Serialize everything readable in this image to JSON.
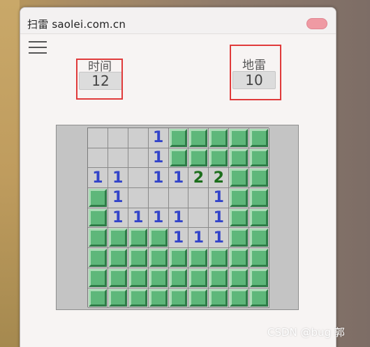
{
  "window": {
    "title": "扫雷 saolei.com.cn"
  },
  "counters": {
    "time": {
      "label": "时间",
      "value": "12"
    },
    "mines": {
      "label": "地雷",
      "value": "10"
    }
  },
  "board": {
    "rows": [
      [
        " ",
        " ",
        " ",
        "1",
        "#",
        "#",
        "#",
        "#",
        "#"
      ],
      [
        " ",
        " ",
        " ",
        "1",
        "#",
        "#",
        "#",
        "#",
        "#"
      ],
      [
        "1",
        "1",
        " ",
        "1",
        "1",
        "2",
        "2",
        "#",
        "#"
      ],
      [
        "#",
        "1",
        " ",
        " ",
        " ",
        " ",
        "1",
        "#",
        "#"
      ],
      [
        "#",
        "1",
        "1",
        "1",
        "1",
        " ",
        "1",
        "#",
        "#"
      ],
      [
        "#",
        "#",
        "#",
        "#",
        "1",
        "1",
        "1",
        "#",
        "#"
      ],
      [
        "#",
        "#",
        "#",
        "#",
        "#",
        "#",
        "#",
        "#",
        "#"
      ],
      [
        "#",
        "#",
        "#",
        "#",
        "#",
        "#",
        "#",
        "#",
        "#"
      ],
      [
        "#",
        "#",
        "#",
        "#",
        "#",
        "#",
        "#",
        "#",
        "#"
      ]
    ]
  },
  "colors": {
    "number_1": "#3344c9",
    "number_2": "#1c6e1c",
    "covered_tile": "#5eb77a",
    "highlight_box": "#e03a3a"
  },
  "watermark": "CSDN @bug 郭"
}
